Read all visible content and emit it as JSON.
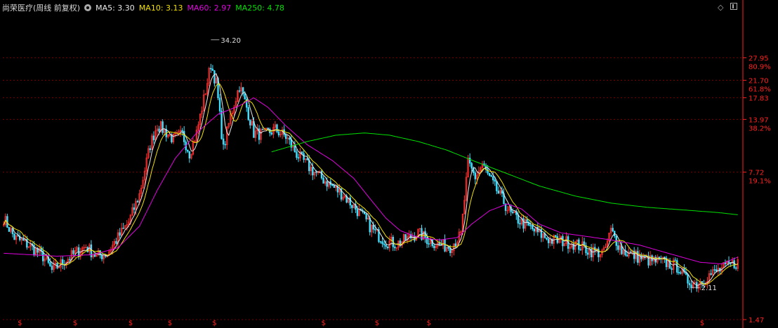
{
  "header": {
    "title": "尚荣医疗(周线 前复权)",
    "ma5_label": "MA5: 3.30",
    "ma10_label": "MA10: 3.13",
    "ma60_label": "MA60: 2.97",
    "ma250_label": "MA250: 4.78"
  },
  "colors": {
    "background": "#000000",
    "up": "#ff3030",
    "down": "#40e0ff",
    "ma5": "#e8e8e8",
    "ma10": "#f2e000",
    "ma60": "#e000e0",
    "ma250": "#00e000",
    "grid": "#7a0000",
    "axis": "#ff2020"
  },
  "icons": [
    "gear-icon",
    "diamond-icon",
    "window-icon",
    "dividend-marker-icon"
  ],
  "chart_data": {
    "type": "line",
    "scale": "log",
    "ylim": [
      1.47,
      45.0
    ],
    "y_ticks": [
      {
        "value": 27.95,
        "label": "27.95",
        "pct": "80.9%"
      },
      {
        "value": 21.7,
        "label": "21.70",
        "pct": "61.8%"
      },
      {
        "value": 17.83,
        "label": "17.83",
        "pct": ""
      },
      {
        "value": 13.97,
        "label": "13.97",
        "pct": "38.2%"
      },
      {
        "value": 7.72,
        "label": "7.72",
        "pct": "19.1%"
      },
      {
        "value": 1.47,
        "label": "1.47",
        "pct": ""
      }
    ],
    "annotations": [
      {
        "label": "34.20",
        "x_index": 116,
        "value": 34.2,
        "kind": "high"
      },
      {
        "label": "2.11",
        "x_index": 385,
        "value": 2.11,
        "kind": "low"
      }
    ],
    "dividend_marker": "$",
    "dividend_x_index": [
      9,
      40,
      71,
      93,
      118,
      179,
      209,
      238,
      391
    ],
    "n_weeks": 412,
    "price_keypoints": [
      [
        0,
        4.6
      ],
      [
        6,
        3.7
      ],
      [
        14,
        3.4
      ],
      [
        22,
        3.0
      ],
      [
        27,
        2.55
      ],
      [
        33,
        2.8
      ],
      [
        40,
        3.1
      ],
      [
        46,
        3.35
      ],
      [
        52,
        3.0
      ],
      [
        58,
        3.1
      ],
      [
        64,
        3.7
      ],
      [
        70,
        4.4
      ],
      [
        76,
        6.0
      ],
      [
        82,
        10.5
      ],
      [
        86,
        13.2
      ],
      [
        90,
        12.3
      ],
      [
        95,
        11.2
      ],
      [
        100,
        11.8
      ],
      [
        104,
        9.6
      ],
      [
        108,
        12.0
      ],
      [
        112,
        17.5
      ],
      [
        116,
        26.0
      ],
      [
        119,
        21.0
      ],
      [
        123,
        10.0
      ],
      [
        127,
        14.5
      ],
      [
        132,
        20.5
      ],
      [
        136,
        16.0
      ],
      [
        140,
        12.0
      ],
      [
        146,
        11.8
      ],
      [
        152,
        12.5
      ],
      [
        158,
        11.5
      ],
      [
        164,
        9.5
      ],
      [
        172,
        8.0
      ],
      [
        180,
        7.0
      ],
      [
        190,
        6.0
      ],
      [
        200,
        4.8
      ],
      [
        208,
        3.9
      ],
      [
        214,
        3.55
      ],
      [
        220,
        3.45
      ],
      [
        226,
        3.65
      ],
      [
        232,
        3.9
      ],
      [
        238,
        3.6
      ],
      [
        244,
        3.4
      ],
      [
        250,
        3.35
      ],
      [
        256,
        3.8
      ],
      [
        260,
        8.5
      ],
      [
        264,
        7.3
      ],
      [
        268,
        8.4
      ],
      [
        272,
        7.2
      ],
      [
        278,
        5.9
      ],
      [
        284,
        4.8
      ],
      [
        290,
        4.4
      ],
      [
        298,
        3.95
      ],
      [
        306,
        3.6
      ],
      [
        314,
        3.55
      ],
      [
        320,
        3.45
      ],
      [
        328,
        3.2
      ],
      [
        336,
        3.1
      ],
      [
        340,
        4.0
      ],
      [
        346,
        3.2
      ],
      [
        354,
        3.0
      ],
      [
        362,
        2.85
      ],
      [
        370,
        2.8
      ],
      [
        378,
        2.65
      ],
      [
        382,
        2.3
      ],
      [
        388,
        2.2
      ],
      [
        394,
        2.4
      ],
      [
        400,
        2.55
      ],
      [
        406,
        2.7
      ],
      [
        411,
        2.8
      ]
    ],
    "ma60_keypoints": [
      [
        0,
        3.1
      ],
      [
        30,
        3.0
      ],
      [
        50,
        3.05
      ],
      [
        64,
        3.3
      ],
      [
        76,
        4.2
      ],
      [
        86,
        6.3
      ],
      [
        96,
        9.0
      ],
      [
        108,
        12.0
      ],
      [
        120,
        14.8
      ],
      [
        132,
        16.3
      ],
      [
        140,
        17.8
      ],
      [
        148,
        16.0
      ],
      [
        158,
        13.0
      ],
      [
        170,
        10.5
      ],
      [
        184,
        8.8
      ],
      [
        196,
        7.2
      ],
      [
        206,
        5.6
      ],
      [
        214,
        4.6
      ],
      [
        222,
        4.0
      ],
      [
        232,
        3.7
      ],
      [
        244,
        3.6
      ],
      [
        254,
        3.7
      ],
      [
        262,
        4.3
      ],
      [
        272,
        5.0
      ],
      [
        282,
        5.4
      ],
      [
        290,
        5.1
      ],
      [
        300,
        4.3
      ],
      [
        312,
        3.9
      ],
      [
        326,
        3.75
      ],
      [
        340,
        3.6
      ],
      [
        356,
        3.4
      ],
      [
        372,
        3.1
      ],
      [
        390,
        2.8
      ],
      [
        402,
        2.75
      ],
      [
        411,
        2.97
      ]
    ],
    "ma250_keypoints": [
      [
        150,
        9.7
      ],
      [
        170,
        10.9
      ],
      [
        186,
        11.7
      ],
      [
        202,
        12.0
      ],
      [
        216,
        11.7
      ],
      [
        232,
        10.9
      ],
      [
        248,
        9.9
      ],
      [
        264,
        8.7
      ],
      [
        280,
        7.7
      ],
      [
        300,
        6.6
      ],
      [
        320,
        5.9
      ],
      [
        340,
        5.45
      ],
      [
        360,
        5.2
      ],
      [
        380,
        5.05
      ],
      [
        400,
        4.9
      ],
      [
        411,
        4.78
      ]
    ]
  }
}
